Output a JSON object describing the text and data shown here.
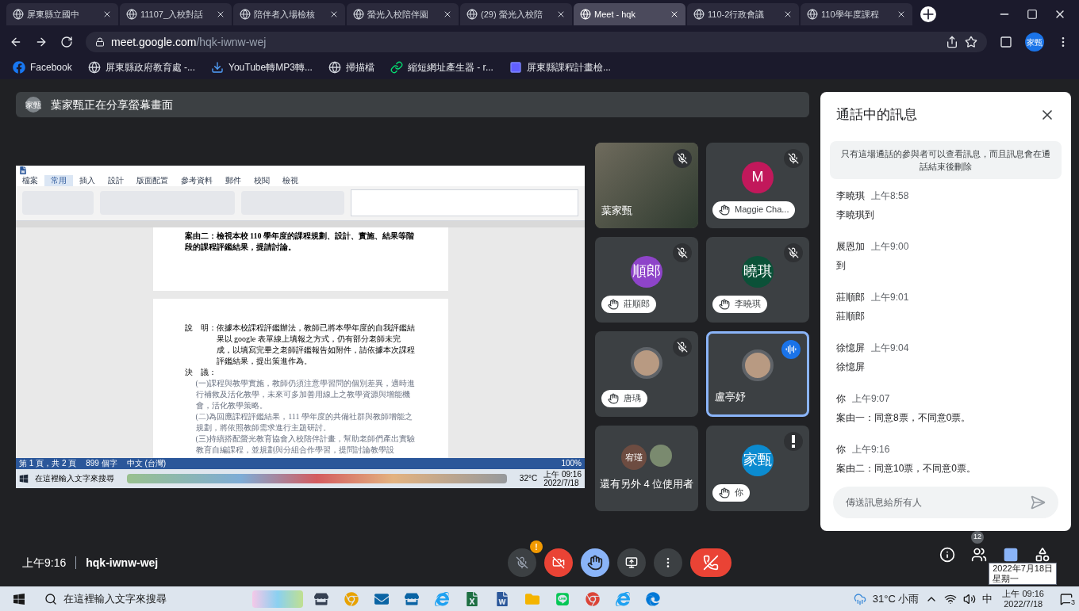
{
  "browser_tabs": [
    {
      "title": "屏東縣立國中",
      "selected": false
    },
    {
      "title": "11107_入校對話",
      "selected": false
    },
    {
      "title": "陪伴者入場檢核",
      "selected": false
    },
    {
      "title": "螢光入校陪伴園",
      "selected": false
    },
    {
      "title": "(29) 螢光入校陪",
      "selected": false
    },
    {
      "title": "Meet - hqk",
      "selected": true
    },
    {
      "title": "110-2行政會議",
      "selected": false
    },
    {
      "title": "110學年度課程",
      "selected": false
    }
  ],
  "address_bar": {
    "host": "meet.google.com",
    "path": "/hqk-iwnw-wej"
  },
  "profile": {
    "initials": "家甄"
  },
  "bookmarks": [
    {
      "label": "Facebook",
      "kind": "facebook"
    },
    {
      "label": "屏東縣政府教育處 -...",
      "kind": "globe"
    },
    {
      "label": "YouTube轉MP3轉...",
      "kind": "download"
    },
    {
      "label": "掃描檔",
      "kind": "globe"
    },
    {
      "label": "縮短網址產生器 - r...",
      "kind": "link"
    },
    {
      "label": "屏東縣課程計畫檢...",
      "kind": "b"
    }
  ],
  "presenting_banner": {
    "avatar": "家甄",
    "text": "葉家甄正在分享螢幕畫面"
  },
  "shared_screen": {
    "ribbon_tabs": [
      {
        "label": "檔案",
        "selected": false
      },
      {
        "label": "常用",
        "selected": true
      },
      {
        "label": "插入",
        "selected": false
      },
      {
        "label": "設計",
        "selected": false
      },
      {
        "label": "版面配置",
        "selected": false
      },
      {
        "label": "參考資料",
        "selected": false
      },
      {
        "label": "郵件",
        "selected": false
      },
      {
        "label": "校閱",
        "selected": false
      },
      {
        "label": "檢視",
        "selected": false
      }
    ],
    "heading": "案由二：檢視本校 110 學年度的課程規劃、設計、實施、結果等階段的課程評鑑結果，提請討論。",
    "explanation_label": "說　明：",
    "explanation": "依據本校課程評鑑辦法，教師已將本學年度的自我評鑑結果以 google 表單線上填報之方式，仍有部分老師未完成，以填寫完畢之老師評鑑報告如附件，請依據本次課程評鑑結果，提出策進作為。",
    "resolution_label": "決　議：",
    "resolutions": [
      "(一)課程與教學實施，教師仍須注意學習問的個別差異，適時進行補救及活化教學，未來可多加善用線上之教學資源與增能機會，活化教學策略。",
      "(二)為回應課程評鑑結果，111 學年度的共備社群與教師增能之規劃，將依照教師需求進行主題研討。",
      "(三)持續搭配螢光教育協會入校陪伴計畫，幫助老師們產出實驗教育自編課程，並規劃與分組合作學習，提問討論教學設"
    ],
    "status_left": [
      "第 1 頁，共 2 頁",
      "899 個字",
      "中文 (台灣)"
    ],
    "zoom": "100%",
    "taskbar_search": "在這裡輸入文字來搜尋",
    "taskbar_weather": "32°C",
    "taskbar_time": "上午 09:16",
    "taskbar_date": "2022/7/18"
  },
  "tiles": [
    {
      "kind": "video",
      "name": "葉家甄",
      "muted": true,
      "alert": false,
      "hand_raised": false,
      "speaking": false
    },
    {
      "kind": "avatar",
      "name": "Maggie Cha...",
      "initial": "M",
      "color": "#c2185b",
      "muted": true,
      "alert": false,
      "hand_raised": true,
      "speaking": false
    },
    {
      "kind": "avatar",
      "name": "莊順郎",
      "initial": "順郎",
      "color": "#8e44c9",
      "muted": true,
      "alert": false,
      "hand_raised": true,
      "speaking": false
    },
    {
      "kind": "avatar",
      "name": "李曉琪",
      "initial": "曉琪",
      "color": "#0b5138",
      "muted": true,
      "alert": false,
      "hand_raised": true,
      "speaking": false
    },
    {
      "kind": "photo",
      "name": "唐瑀",
      "muted": true,
      "alert": false,
      "hand_raised": true,
      "speaking": false
    },
    {
      "kind": "photo",
      "name": "盧亭妤",
      "muted": false,
      "alert": false,
      "hand_raised": false,
      "speaking": true
    },
    {
      "kind": "overflow",
      "name": "還有另外 4 位使用者",
      "initial": "宥瑾",
      "speaking": false
    },
    {
      "kind": "avatar",
      "name": "你",
      "initial": "家甄",
      "color": "#0b8bd0",
      "muted": false,
      "alert": true,
      "hand_raised": true,
      "speaking": false
    }
  ],
  "chat": {
    "title": "通話中的訊息",
    "notice": "只有這場通話的參與者可以查看訊息，而且訊息會在通話結束後刪除",
    "messages": [
      {
        "sender": "李曉琪",
        "time": "上午8:58",
        "text": "李曉琪到"
      },
      {
        "sender": "展恩加",
        "time": "上午9:00",
        "text": "到"
      },
      {
        "sender": "莊順郎",
        "time": "上午9:01",
        "text": "莊順郎"
      },
      {
        "sender": "徐憶屏",
        "time": "上午9:04",
        "text": "徐憶屏"
      },
      {
        "sender": "你",
        "time": "上午9:07",
        "text": "案由一：同意8票，不同意0票。"
      },
      {
        "sender": "你",
        "time": "上午9:16",
        "text": "案由二：同意10票，不同意0票。"
      }
    ],
    "placeholder": "傳送訊息給所有人"
  },
  "meeting_info": {
    "time": "上午9:16",
    "code": "hqk-iwnw-wej"
  },
  "controls": {
    "mic_on": false,
    "mic_alert": "!",
    "camera_on": false,
    "hand_raised": true
  },
  "people_count": "12",
  "date_tooltip": {
    "date": "2022年7月18日",
    "weekday": "星期一"
  },
  "taskbar": {
    "search_placeholder": "在這裡輸入文字來搜尋",
    "weather": "31°C 小雨",
    "ime": "中",
    "time": "上午 09:16",
    "date": "2022/7/18",
    "notifications": "3"
  }
}
